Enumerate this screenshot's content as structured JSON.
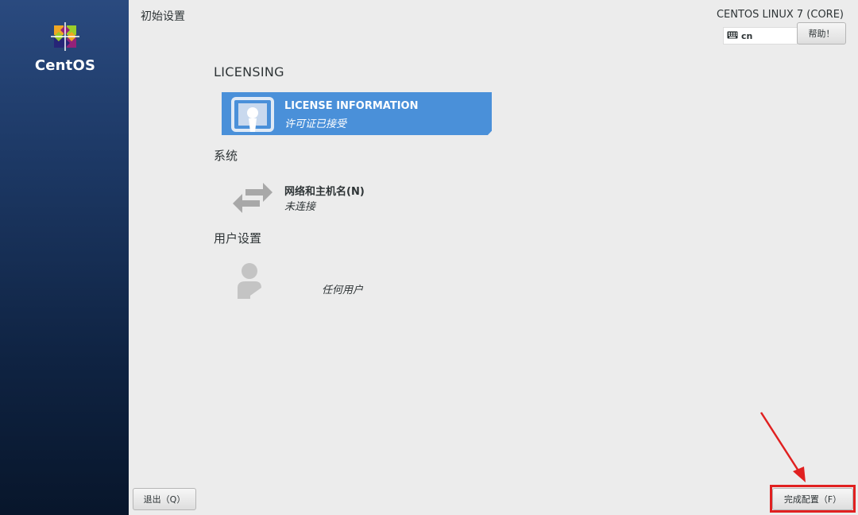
{
  "brand": {
    "name": "CentOS"
  },
  "header": {
    "title": "初始设置",
    "product": "CENTOS LINUX 7 (CORE)",
    "keyboard_layout": "cn",
    "help_label": "帮助！"
  },
  "sections": {
    "licensing": {
      "label": "LICENSING",
      "license_spoke": {
        "title": "LICENSE INFORMATION",
        "status": "许可证已接受"
      }
    },
    "system": {
      "label": "系统",
      "network_spoke": {
        "title": "网络和主机名(N)",
        "status": "未连接"
      }
    },
    "user_settings": {
      "label": "用户设置",
      "user_spoke": {
        "status": "任何用户"
      }
    }
  },
  "footer": {
    "quit_label": "退出（Q）",
    "finish_label": "完成配置（F）"
  },
  "colors": {
    "selected_spoke": "#4a90d9",
    "highlight": "#e02020"
  }
}
